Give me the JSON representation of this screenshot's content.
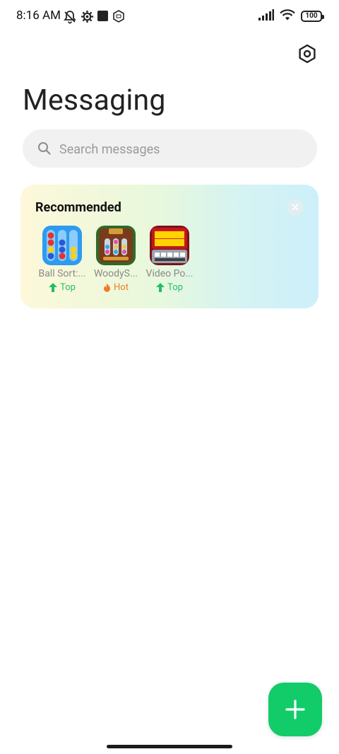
{
  "status_bar": {
    "time": "8:16 AM",
    "battery": "100",
    "icons": [
      "mute-bell-icon",
      "gear-notification-icon",
      "square-notification-icon",
      "hexagon-notification-icon",
      "signal-icon",
      "wifi-icon",
      "battery-icon"
    ]
  },
  "header": {
    "title": "Messaging",
    "settings_icon": "settings-hexagon-icon"
  },
  "search": {
    "placeholder": "Search messages",
    "value": ""
  },
  "recommended": {
    "title": "Recommended",
    "close_icon": "close-icon",
    "apps": [
      {
        "name": "Ball Sort:...",
        "badge": "Top",
        "badge_type": "top"
      },
      {
        "name": "WoodyS...",
        "badge": "Hot",
        "badge_type": "hot"
      },
      {
        "name": "Video Po...",
        "badge": "Top",
        "badge_type": "top"
      }
    ]
  },
  "fab": {
    "icon": "plus-icon"
  },
  "colors": {
    "accent_green": "#12cc6a",
    "badge_top": "#1fbf6a",
    "badge_hot": "#f07a27"
  }
}
